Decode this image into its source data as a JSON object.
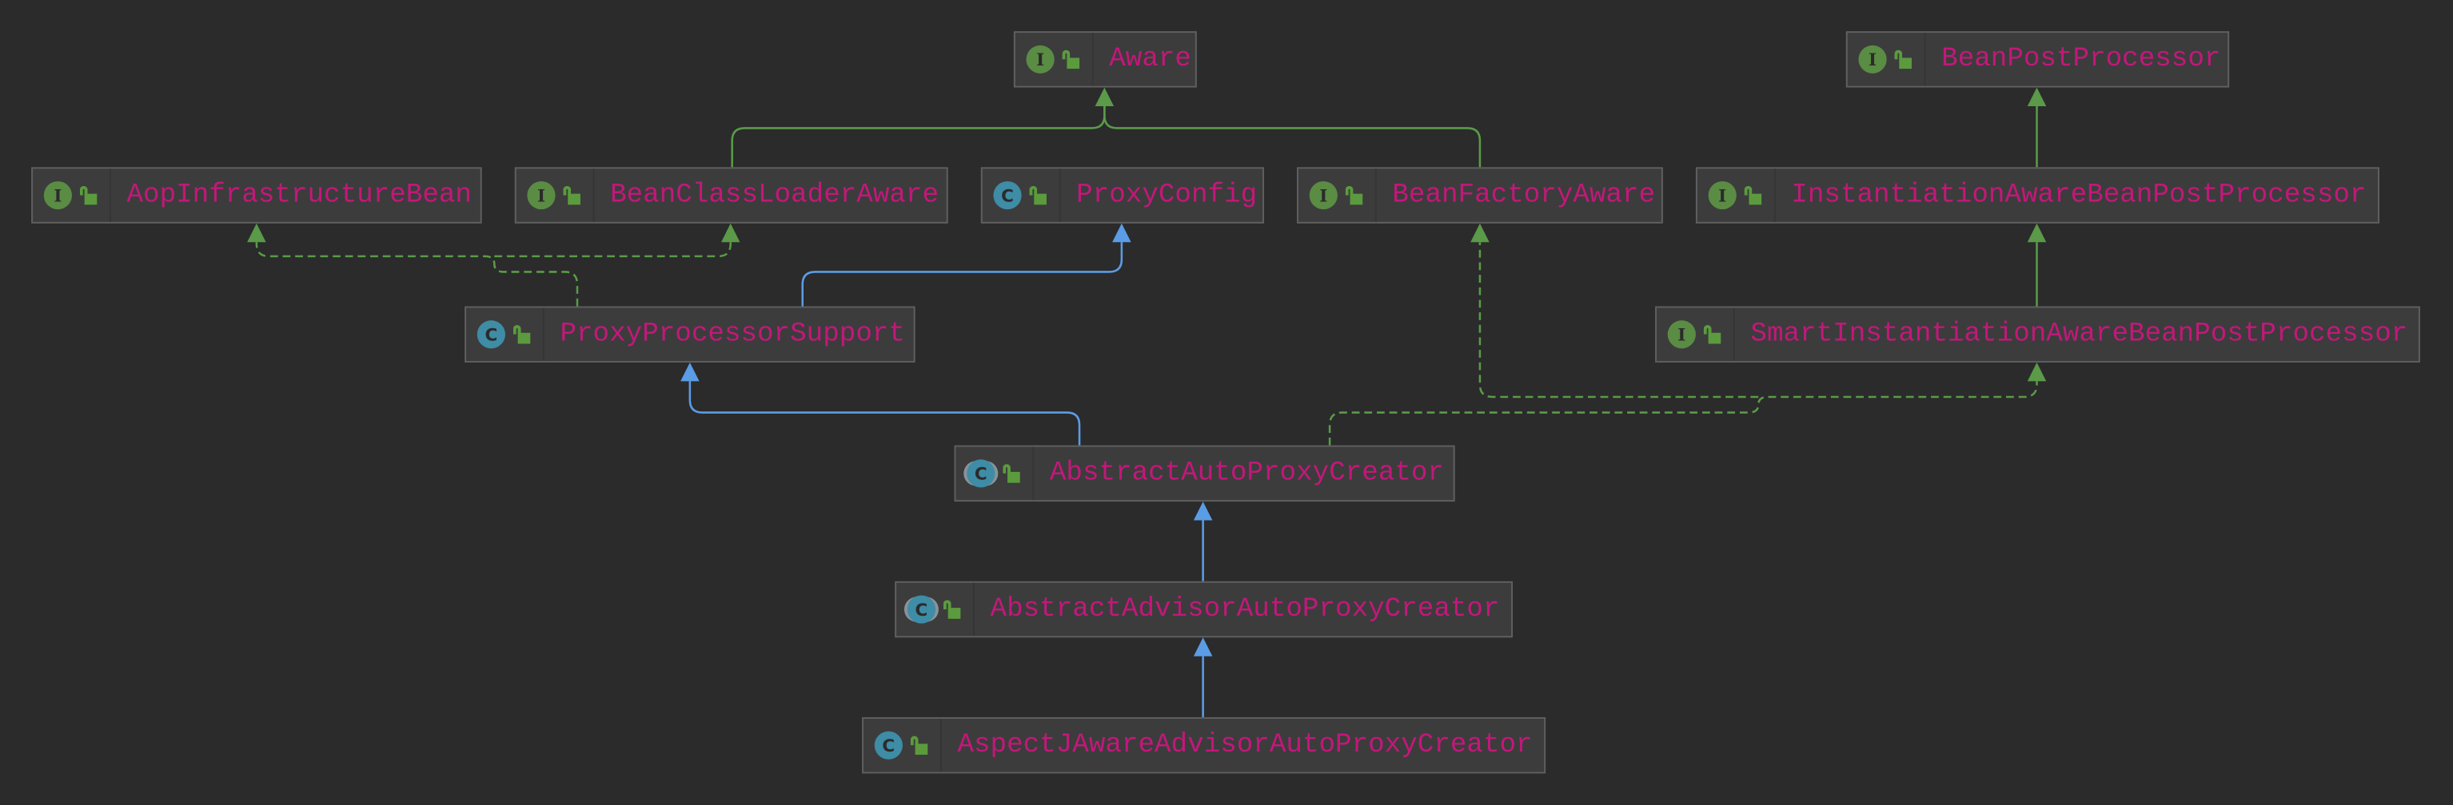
{
  "colors": {
    "background": "#2b2b2b",
    "node_fill": "#3c3c3c",
    "node_border": "#5f5f5f",
    "label": "#c2187a",
    "interface_badge": "#5a8c44",
    "class_badge": "#3e8ca6",
    "implements_edge": "#5a9a48",
    "extends_edge": "#5b9ce6"
  },
  "nodes": [
    {
      "id": "aware",
      "name": "Aware",
      "kind": "interface",
      "badge": "I"
    },
    {
      "id": "bpp",
      "name": "BeanPostProcessor",
      "kind": "interface",
      "badge": "I"
    },
    {
      "id": "aop",
      "name": "AopInfrastructureBean",
      "kind": "interface",
      "badge": "I"
    },
    {
      "id": "bcla",
      "name": "BeanClassLoaderAware",
      "kind": "interface",
      "badge": "I"
    },
    {
      "id": "pc",
      "name": "ProxyConfig",
      "kind": "class",
      "badge": "C"
    },
    {
      "id": "bfa",
      "name": "BeanFactoryAware",
      "kind": "interface",
      "badge": "I"
    },
    {
      "id": "iabpp",
      "name": "InstantiationAwareBeanPostProcessor",
      "kind": "interface",
      "badge": "I"
    },
    {
      "id": "pps",
      "name": "ProxyProcessorSupport",
      "kind": "class",
      "badge": "C"
    },
    {
      "id": "siabpp",
      "name": "SmartInstantiationAwareBeanPostProcessor",
      "kind": "interface",
      "badge": "I"
    },
    {
      "id": "aapc",
      "name": "AbstractAutoProxyCreator",
      "kind": "abstract",
      "badge": "C"
    },
    {
      "id": "aaapc",
      "name": "AbstractAdvisorAutoProxyCreator",
      "kind": "abstract",
      "badge": "C"
    },
    {
      "id": "ajaapc",
      "name": "AspectJAwareAdvisorAutoProxyCreator",
      "kind": "class",
      "badge": "C"
    }
  ],
  "edges": [
    {
      "from": "bcla",
      "to": "aware",
      "type": "extends-interface"
    },
    {
      "from": "bfa",
      "to": "aware",
      "type": "extends-interface"
    },
    {
      "from": "iabpp",
      "to": "bpp",
      "type": "extends-interface"
    },
    {
      "from": "siabpp",
      "to": "iabpp",
      "type": "extends-interface"
    },
    {
      "from": "pps",
      "to": "aop",
      "type": "implements"
    },
    {
      "from": "pps",
      "to": "bcla",
      "type": "implements"
    },
    {
      "from": "pps",
      "to": "pc",
      "type": "extends"
    },
    {
      "from": "aapc",
      "to": "pps",
      "type": "extends"
    },
    {
      "from": "aapc",
      "to": "bfa",
      "type": "implements"
    },
    {
      "from": "aapc",
      "to": "siabpp",
      "type": "implements"
    },
    {
      "from": "aaapc",
      "to": "aapc",
      "type": "extends"
    },
    {
      "from": "ajaapc",
      "to": "aaapc",
      "type": "extends"
    }
  ]
}
